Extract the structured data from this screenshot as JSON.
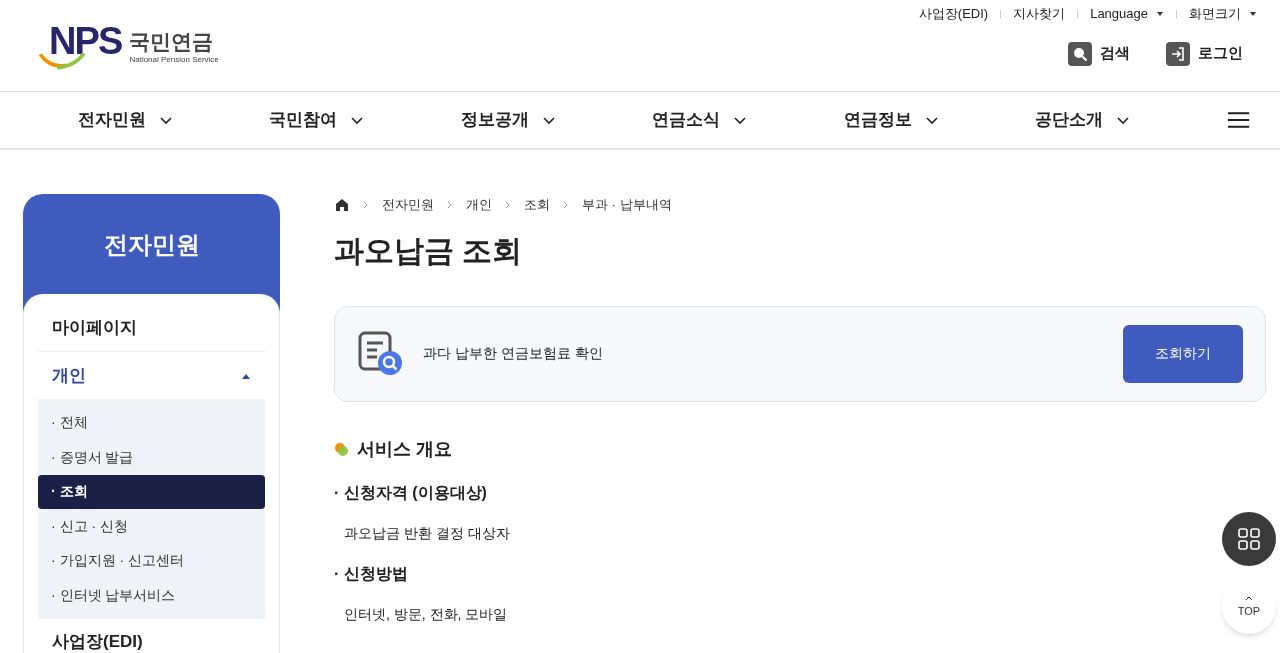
{
  "logo": {
    "mark": "NPS",
    "name": "국민연금",
    "subtitle": "National Pension Service"
  },
  "utility_links": [
    {
      "label": "사업장(EDI)",
      "kind": "link"
    },
    {
      "label": "지사찾기",
      "kind": "link"
    },
    {
      "label": "Language",
      "kind": "dropdown"
    },
    {
      "label": "화면크기",
      "kind": "dropdown"
    }
  ],
  "header_actions": [
    {
      "label": "검색",
      "kind": "search"
    },
    {
      "label": "로그인",
      "kind": "login"
    }
  ],
  "nav": [
    "전자민원",
    "국민참여",
    "정보공개",
    "연금소식",
    "연금정보",
    "공단소개"
  ],
  "sidebar": {
    "title": "전자민원",
    "items": [
      {
        "label": "마이페이지",
        "expanded": false
      },
      {
        "label": "개인",
        "expanded": true,
        "children": [
          {
            "label": "· 전체",
            "selected": false
          },
          {
            "label": "· 증명서 발급",
            "selected": false
          },
          {
            "label": "· 조회",
            "selected": true
          },
          {
            "label": "· 신고 · 신청",
            "selected": false
          },
          {
            "label": "· 가입지원 · 신고센터",
            "selected": false
          },
          {
            "label": "· 인터넷 납부서비스",
            "selected": false
          }
        ]
      },
      {
        "label": "사업장(EDI)",
        "expanded": false
      }
    ]
  },
  "breadcrumb": [
    "전자민원",
    "개인",
    "조회",
    "부과 · 납부내역"
  ],
  "page_title": "과오납금 조회",
  "service_card": {
    "description": "과다 납부한 연금보험료 확인",
    "button": "조회하기"
  },
  "section_title": "서비스 개요",
  "subsections": [
    {
      "heading": "· 신청자격 (이용대상)",
      "body": "과오납금 반환 결정 대상자"
    },
    {
      "heading": "· 신청방법",
      "body": "인터넷, 방문, 전화, 모바일"
    }
  ],
  "floating": {
    "top_label": "TOP"
  }
}
